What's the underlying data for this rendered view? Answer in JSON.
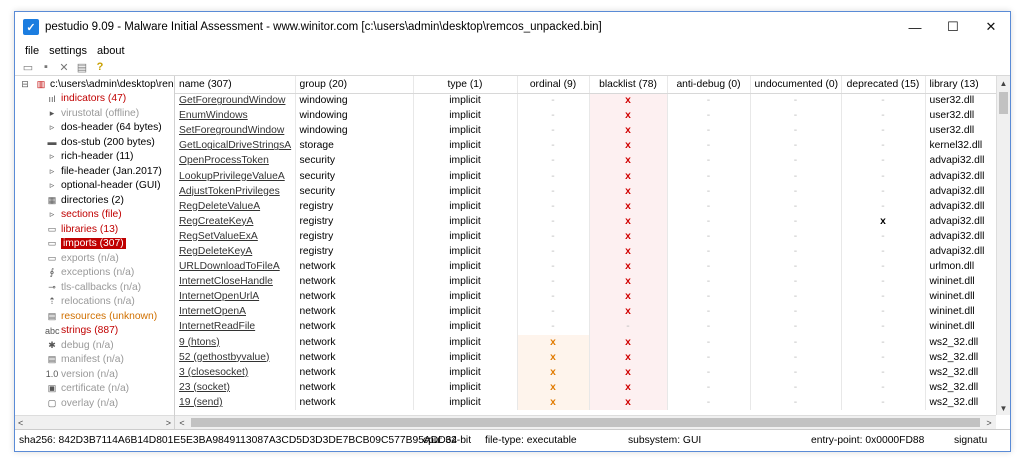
{
  "window": {
    "title": "pestudio 9.09 - Malware Initial Assessment - www.winitor.com [c:\\users\\admin\\desktop\\remcos_unpacked.bin]",
    "minimize": "—",
    "maximize": "☐",
    "close": "✕"
  },
  "menu": [
    "file",
    "settings",
    "about"
  ],
  "toolbar": {
    "help": "?"
  },
  "tree": {
    "root": "c:\\users\\admin\\desktop\\ren",
    "items": [
      {
        "label": "indicators (47)",
        "color": "red",
        "icon": "indicators-icon",
        "glyph": "ııl"
      },
      {
        "label": "virustotal (offline)",
        "color": "gray",
        "icon": "virustotal-icon",
        "glyph": "▸"
      },
      {
        "label": "dos-header (64 bytes)",
        "color": "black",
        "icon": "arrow-icon",
        "glyph": "▹"
      },
      {
        "label": "dos-stub (200 bytes)",
        "color": "black",
        "icon": "dos-stub-icon",
        "glyph": "▬"
      },
      {
        "label": "rich-header (11)",
        "color": "black",
        "icon": "arrow-icon",
        "glyph": "▹"
      },
      {
        "label": "file-header (Jan.2017)",
        "color": "black",
        "icon": "arrow-icon",
        "glyph": "▹"
      },
      {
        "label": "optional-header (GUI)",
        "color": "black",
        "icon": "arrow-icon",
        "glyph": "▹"
      },
      {
        "label": "directories (2)",
        "color": "black",
        "icon": "directories-icon",
        "glyph": "▦"
      },
      {
        "label": "sections (file)",
        "color": "red",
        "icon": "arrow-icon",
        "glyph": "▹"
      },
      {
        "label": "libraries (13)",
        "color": "red",
        "icon": "libraries-icon",
        "glyph": "▭"
      },
      {
        "label": "imports (307)",
        "color": "selected",
        "icon": "imports-icon",
        "glyph": "▭"
      },
      {
        "label": "exports (n/a)",
        "color": "gray",
        "icon": "exports-icon",
        "glyph": "▭"
      },
      {
        "label": "exceptions (n/a)",
        "color": "gray",
        "icon": "exceptions-icon",
        "glyph": "∮"
      },
      {
        "label": "tls-callbacks (n/a)",
        "color": "gray",
        "icon": "tls-callbacks-icon",
        "glyph": "⊸"
      },
      {
        "label": "relocations (n/a)",
        "color": "gray",
        "icon": "relocations-icon",
        "glyph": "⇡"
      },
      {
        "label": "resources (unknown)",
        "color": "orange",
        "icon": "resources-icon",
        "glyph": "▤"
      },
      {
        "label": "strings (887)",
        "color": "red",
        "icon": "strings-icon",
        "glyph": "abc"
      },
      {
        "label": "debug (n/a)",
        "color": "gray",
        "icon": "debug-icon",
        "glyph": "✱"
      },
      {
        "label": "manifest (n/a)",
        "color": "gray",
        "icon": "manifest-icon",
        "glyph": "▤"
      },
      {
        "label": "version (n/a)",
        "color": "gray",
        "icon": "version-icon",
        "glyph": "1.0"
      },
      {
        "label": "certificate (n/a)",
        "color": "gray",
        "icon": "certificate-icon",
        "glyph": "▣"
      },
      {
        "label": "overlay (n/a)",
        "color": "gray",
        "icon": "overlay-icon",
        "glyph": "▢"
      }
    ]
  },
  "table": {
    "columns": [
      "name (307)",
      "group (20)",
      "type (1)",
      "ordinal (9)",
      "blacklist (78)",
      "anti-debug (0)",
      "undocumented (0)",
      "deprecated (15)",
      "library (13)"
    ],
    "rows": [
      {
        "name": "GetForegroundWindow",
        "group": "windowing",
        "type": "implicit",
        "ordinal": "-",
        "blacklist": "x",
        "antidebug": "-",
        "undocumented": "-",
        "deprecated": "-",
        "library": "user32.dll"
      },
      {
        "name": "EnumWindows",
        "group": "windowing",
        "type": "implicit",
        "ordinal": "-",
        "blacklist": "x",
        "antidebug": "-",
        "undocumented": "-",
        "deprecated": "-",
        "library": "user32.dll"
      },
      {
        "name": "SetForegroundWindow",
        "group": "windowing",
        "type": "implicit",
        "ordinal": "-",
        "blacklist": "x",
        "antidebug": "-",
        "undocumented": "-",
        "deprecated": "-",
        "library": "user32.dll"
      },
      {
        "name": "GetLogicalDriveStringsA",
        "group": "storage",
        "type": "implicit",
        "ordinal": "-",
        "blacklist": "x",
        "antidebug": "-",
        "undocumented": "-",
        "deprecated": "-",
        "library": "kernel32.dll"
      },
      {
        "name": "OpenProcessToken",
        "group": "security",
        "type": "implicit",
        "ordinal": "-",
        "blacklist": "x",
        "antidebug": "-",
        "undocumented": "-",
        "deprecated": "-",
        "library": "advapi32.dll"
      },
      {
        "name": "LookupPrivilegeValueA",
        "group": "security",
        "type": "implicit",
        "ordinal": "-",
        "blacklist": "x",
        "antidebug": "-",
        "undocumented": "-",
        "deprecated": "-",
        "library": "advapi32.dll"
      },
      {
        "name": "AdjustTokenPrivileges",
        "group": "security",
        "type": "implicit",
        "ordinal": "-",
        "blacklist": "x",
        "antidebug": "-",
        "undocumented": "-",
        "deprecated": "-",
        "library": "advapi32.dll"
      },
      {
        "name": "RegDeleteValueA",
        "group": "registry",
        "type": "implicit",
        "ordinal": "-",
        "blacklist": "x",
        "antidebug": "-",
        "undocumented": "-",
        "deprecated": "-",
        "library": "advapi32.dll"
      },
      {
        "name": "RegCreateKeyA",
        "group": "registry",
        "type": "implicit",
        "ordinal": "-",
        "blacklist": "x",
        "antidebug": "-",
        "undocumented": "-",
        "deprecated": "x",
        "library": "advapi32.dll"
      },
      {
        "name": "RegSetValueExA",
        "group": "registry",
        "type": "implicit",
        "ordinal": "-",
        "blacklist": "x",
        "antidebug": "-",
        "undocumented": "-",
        "deprecated": "-",
        "library": "advapi32.dll"
      },
      {
        "name": "RegDeleteKeyA",
        "group": "registry",
        "type": "implicit",
        "ordinal": "-",
        "blacklist": "x",
        "antidebug": "-",
        "undocumented": "-",
        "deprecated": "-",
        "library": "advapi32.dll"
      },
      {
        "name": "URLDownloadToFileA",
        "group": "network",
        "type": "implicit",
        "ordinal": "-",
        "blacklist": "x",
        "antidebug": "-",
        "undocumented": "-",
        "deprecated": "-",
        "library": "urlmon.dll"
      },
      {
        "name": "InternetCloseHandle",
        "group": "network",
        "type": "implicit",
        "ordinal": "-",
        "blacklist": "x",
        "antidebug": "-",
        "undocumented": "-",
        "deprecated": "-",
        "library": "wininet.dll"
      },
      {
        "name": "InternetOpenUrlA",
        "group": "network",
        "type": "implicit",
        "ordinal": "-",
        "blacklist": "x",
        "antidebug": "-",
        "undocumented": "-",
        "deprecated": "-",
        "library": "wininet.dll"
      },
      {
        "name": "InternetOpenA",
        "group": "network",
        "type": "implicit",
        "ordinal": "-",
        "blacklist": "x",
        "antidebug": "-",
        "undocumented": "-",
        "deprecated": "-",
        "library": "wininet.dll"
      },
      {
        "name": "InternetReadFile",
        "group": "network",
        "type": "implicit",
        "ordinal": "-",
        "blacklist": "-",
        "antidebug": "-",
        "undocumented": "-",
        "deprecated": "-",
        "library": "wininet.dll"
      },
      {
        "name": "9 (htons)",
        "group": "network",
        "type": "implicit",
        "ordinal": "x",
        "blacklist": "x",
        "antidebug": "-",
        "undocumented": "-",
        "deprecated": "-",
        "library": "ws2_32.dll"
      },
      {
        "name": "52 (gethostbyvalue)",
        "group": "network",
        "type": "implicit",
        "ordinal": "x",
        "blacklist": "x",
        "antidebug": "-",
        "undocumented": "-",
        "deprecated": "-",
        "library": "ws2_32.dll"
      },
      {
        "name": "3 (closesocket)",
        "group": "network",
        "type": "implicit",
        "ordinal": "x",
        "blacklist": "x",
        "antidebug": "-",
        "undocumented": "-",
        "deprecated": "-",
        "library": "ws2_32.dll"
      },
      {
        "name": "23 (socket)",
        "group": "network",
        "type": "implicit",
        "ordinal": "x",
        "blacklist": "x",
        "antidebug": "-",
        "undocumented": "-",
        "deprecated": "-",
        "library": "ws2_32.dll"
      },
      {
        "name": "19 (send)",
        "group": "network",
        "type": "implicit",
        "ordinal": "x",
        "blacklist": "x",
        "antidebug": "-",
        "undocumented": "-",
        "deprecated": "-",
        "library": "ws2_32.dll"
      }
    ]
  },
  "status": {
    "sha256": "sha256: 842D3B7114A6B14D801E5E3BA9849113087A3CD5D3D3DE7BCB09C577B95ADD64",
    "cpu": "cpu: 32-bit",
    "filetype": "file-type: executable",
    "subsystem": "subsystem: GUI",
    "entrypoint": "entry-point: 0x0000FD88",
    "signature": "signatu"
  },
  "colors": {
    "accent": "#c00000",
    "orange": "#e07a00",
    "border": "#5a8bd6"
  }
}
